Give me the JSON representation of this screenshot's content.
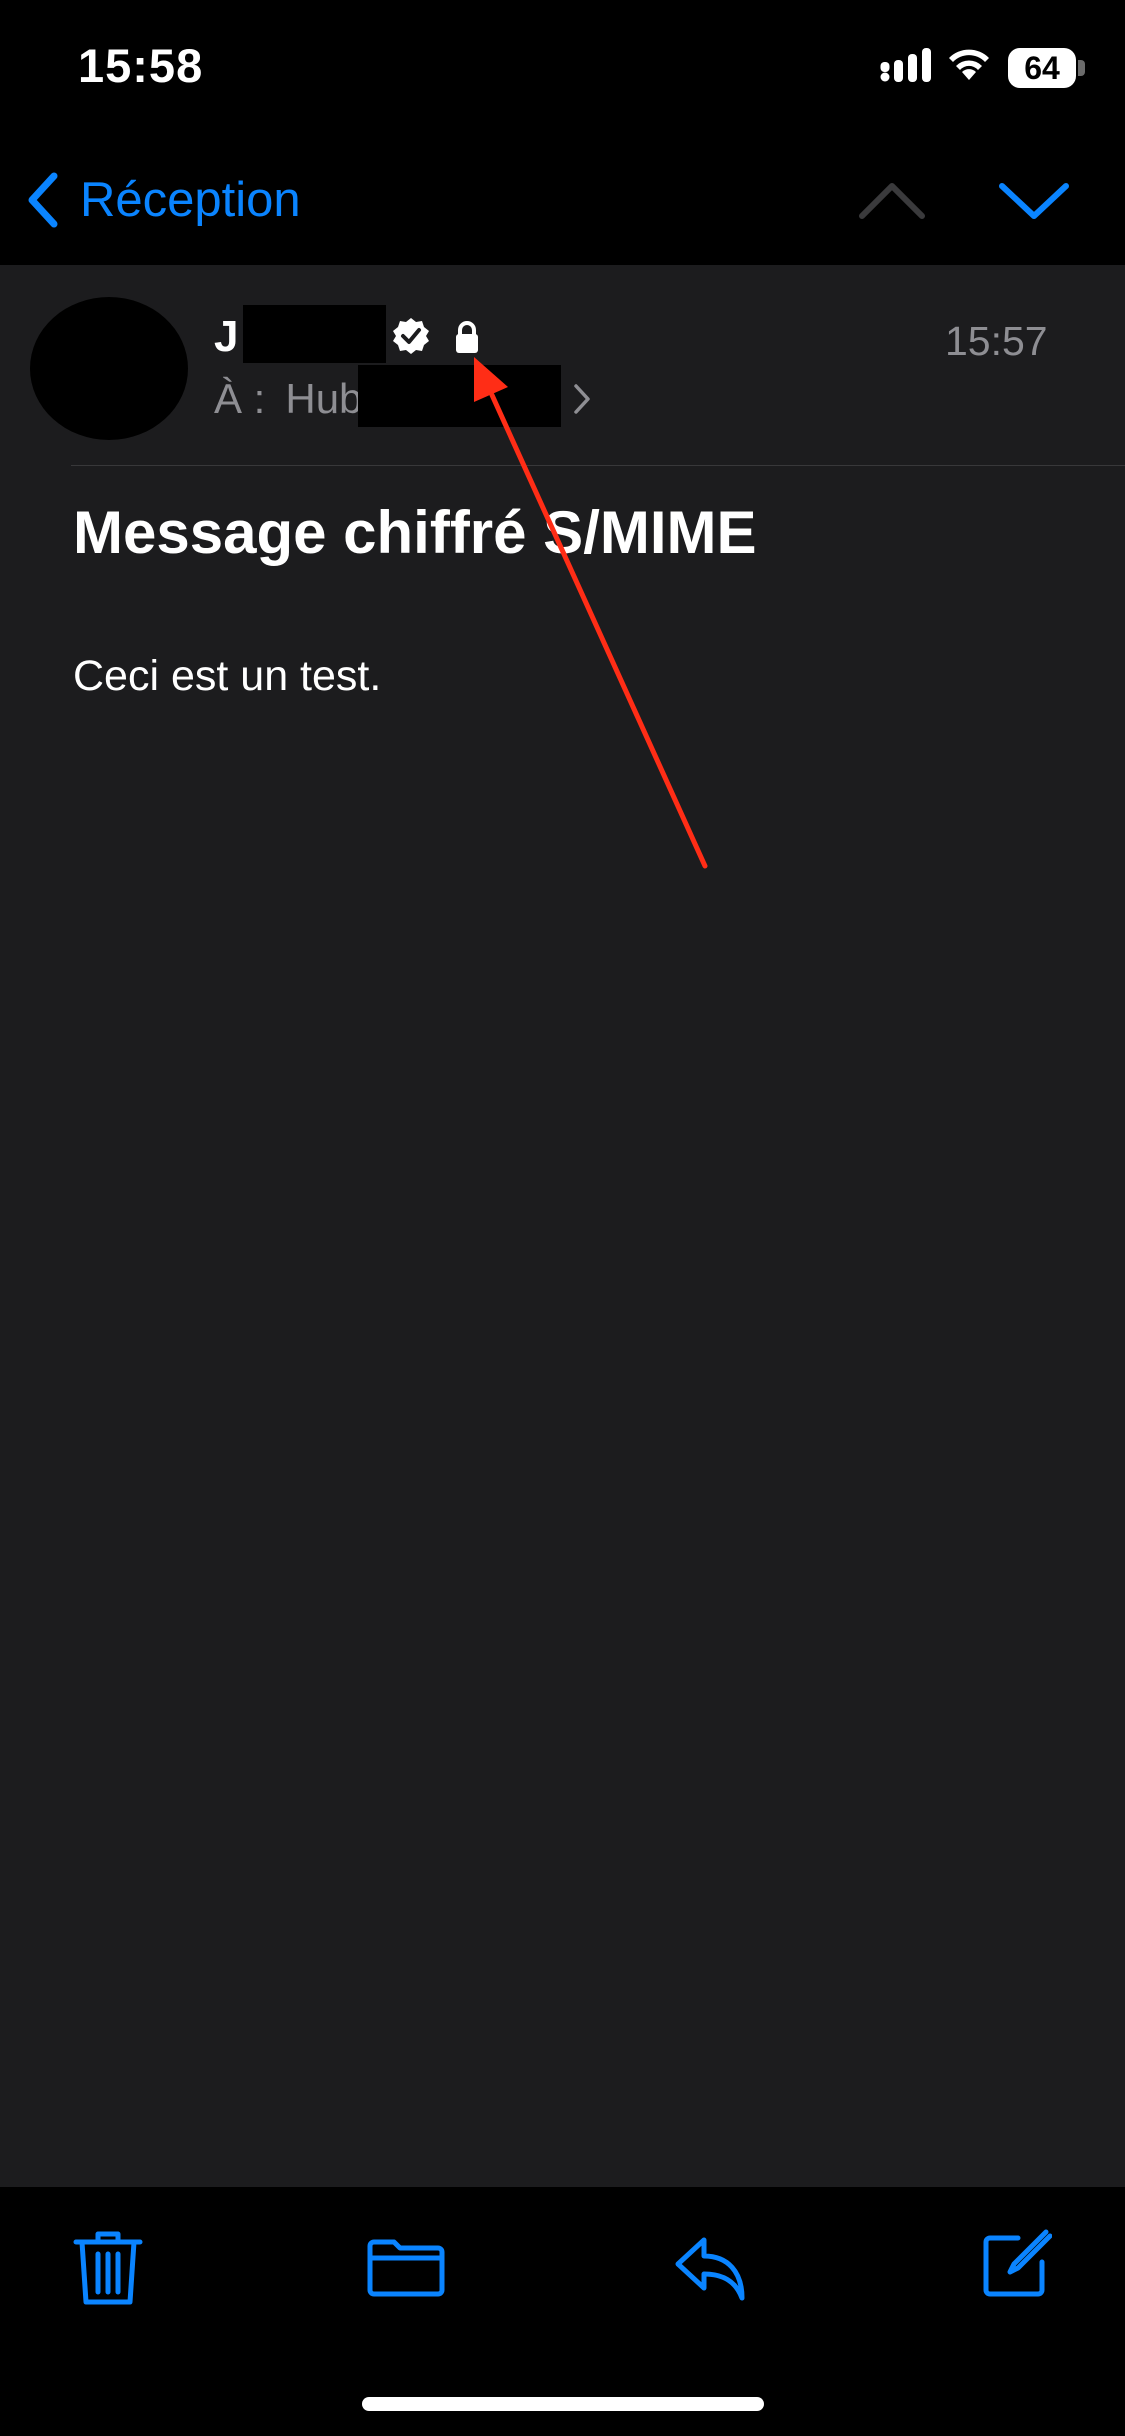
{
  "status_bar": {
    "time": "15:58",
    "battery": "64"
  },
  "nav": {
    "back_label": "Réception"
  },
  "message": {
    "sender_visible": "J",
    "received_time": "15:57",
    "to_label": "À :",
    "recipient_visible": "Hub",
    "subject": "Message chiffré S/MIME",
    "body": "Ceci est un test."
  },
  "icons": {
    "back": "chevron-left-icon",
    "prev": "chevron-up-icon",
    "next": "chevron-down-icon",
    "verified": "verified-badge-icon",
    "lock": "lock-icon",
    "trash": "trash-icon",
    "folder": "folder-icon",
    "reply": "reply-icon",
    "compose": "compose-icon"
  },
  "colors": {
    "accent": "#0a84ff",
    "background": "#1c1c1e",
    "bar_background": "#000000",
    "secondary_text": "#8e8e93",
    "annotation": "#ff2d16"
  }
}
